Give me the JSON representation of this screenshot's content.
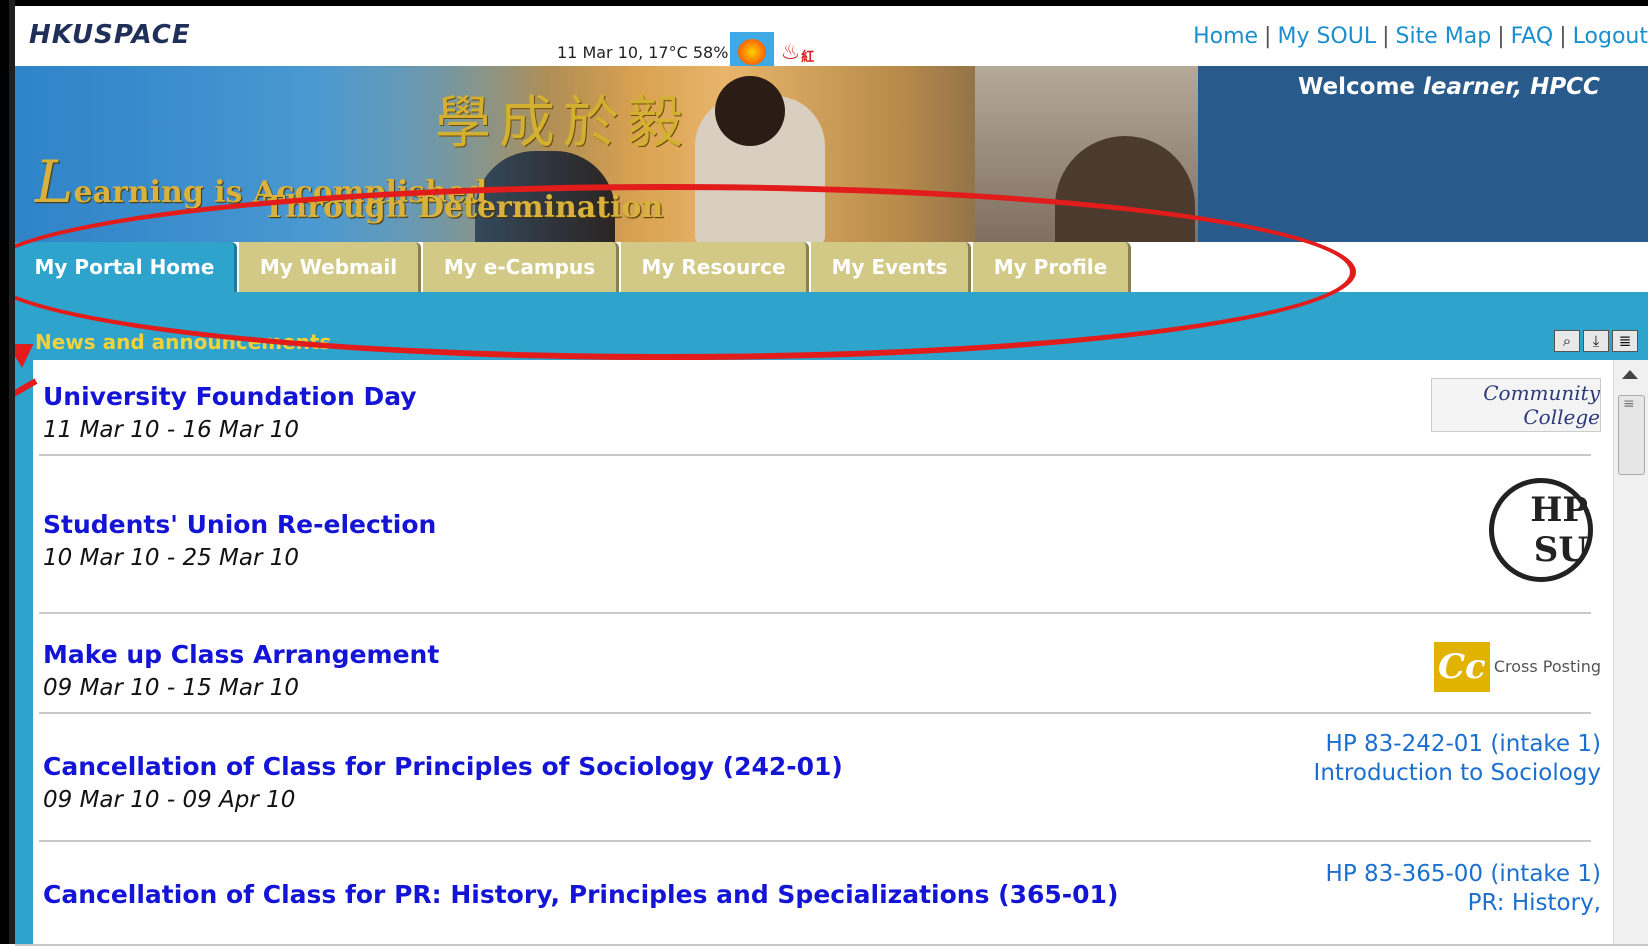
{
  "header": {
    "logo": "HKUSPACE",
    "weather_text": "11 Mar 10, 17°C 58%",
    "fire_label": "紅",
    "links": [
      "Home",
      "My SOUL",
      "Site Map",
      "FAQ",
      "Logout"
    ]
  },
  "banner": {
    "chinese": "學成於毅",
    "motto_big": "L",
    "motto_line1": "earning is Accomplished",
    "motto_line2": "Through Determination",
    "welcome_prefix": "Welcome ",
    "welcome_user": "learner, HPCC"
  },
  "tabs": [
    "My Portal Home",
    "My Webmail",
    "My e-Campus",
    "My Resource",
    "My Events",
    "My Profile"
  ],
  "news": {
    "section_title": "News and announcements",
    "tool_icons": [
      "search-icon",
      "download-icon",
      "list-icon"
    ],
    "items": [
      {
        "title": "University Foundation Day",
        "date": "11 Mar 10 - 16 Mar 10",
        "side": "Community College"
      },
      {
        "title": "Students' Union Re-election",
        "date": "10 Mar 10 - 25 Mar 10",
        "side": "HP SU"
      },
      {
        "title": "Make up Class Arrangement",
        "date": "09 Mar 10 - 15 Mar 10",
        "side": "Cross Posting"
      },
      {
        "title": "Cancellation of Class for Principles of Sociology (242-01)",
        "date": "09 Mar 10 - 09 Apr 10",
        "side": "HP 83-242-01 (intake 1) Introduction to Sociology"
      },
      {
        "title": "Cancellation of Class for PR: History, Principles and Specializations (365-01)",
        "date": "",
        "side": "HP 83-365-00 (intake 1) PR: History,"
      }
    ]
  },
  "colors": {
    "accent": "#2ea3cc",
    "tab_inactive": "#d2c987",
    "link": "#1414d6",
    "annotation": "#e21b1b"
  }
}
